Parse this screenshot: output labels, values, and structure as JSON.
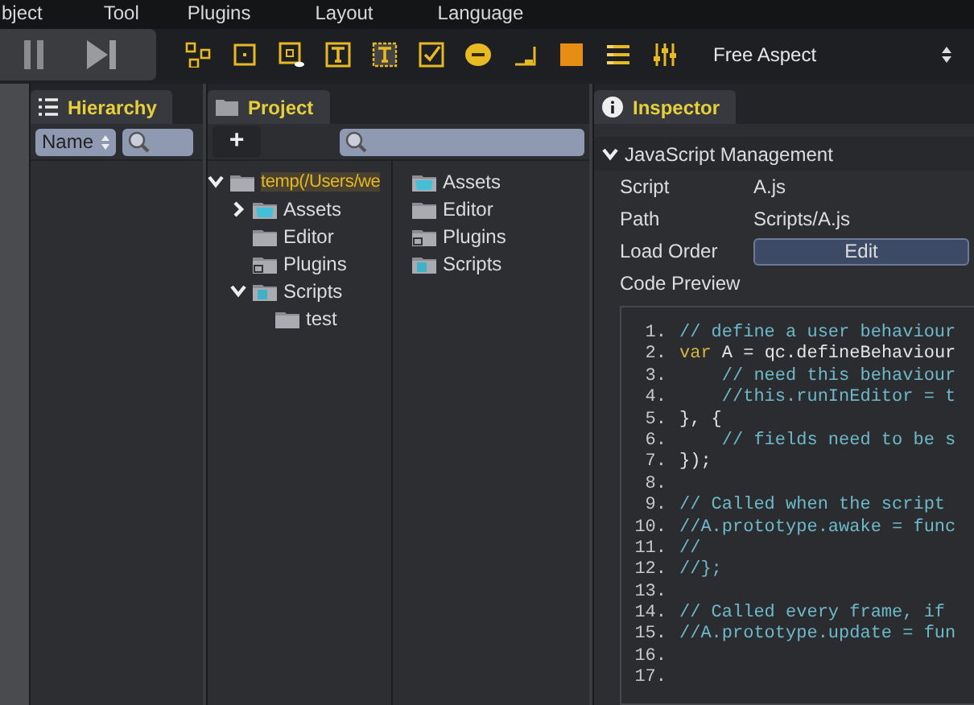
{
  "menu": [
    "bject",
    "Tool",
    "Plugins",
    "Layout",
    "Language"
  ],
  "toolbar": {
    "aspect": "Free Aspect"
  },
  "hierarchy": {
    "title": "Hierarchy",
    "sort": "Name"
  },
  "project": {
    "title": "Project",
    "add": "+",
    "tree": [
      {
        "label": "temp(/Users/we",
        "kind": "plain",
        "selected": true,
        "expanded": true,
        "children": [
          {
            "label": "Assets",
            "kind": "assets",
            "selected": false,
            "expanded": false
          },
          {
            "label": "Editor",
            "kind": "plain",
            "selected": false
          },
          {
            "label": "Plugins",
            "kind": "plugins",
            "selected": false
          },
          {
            "label": "Scripts",
            "kind": "scripts",
            "selected": false,
            "expanded": true,
            "children": [
              {
                "label": "test",
                "kind": "plain",
                "selected": false
              }
            ]
          }
        ]
      }
    ],
    "files": [
      {
        "label": "Assets",
        "kind": "assets"
      },
      {
        "label": "Editor",
        "kind": "plain"
      },
      {
        "label": "Plugins",
        "kind": "plugins"
      },
      {
        "label": "Scripts",
        "kind": "scripts"
      }
    ]
  },
  "inspector": {
    "title": "Inspector",
    "section": {
      "title": "JavaScript Management",
      "expanded": true
    },
    "props": [
      {
        "label": "Script",
        "value": "A.js",
        "kind": "text"
      },
      {
        "label": "Path",
        "value": "Scripts/A.js",
        "kind": "text"
      },
      {
        "label": "Load Order",
        "value": "Edit",
        "kind": "button"
      }
    ],
    "code_label": "Code Preview",
    "code": [
      {
        "n": "1.",
        "comment": "// define a user behaviour"
      },
      {
        "n": "2.",
        "keyword": "var",
        "code": "A = qc.defineBehaviour"
      },
      {
        "n": "3.",
        "comment": "    // need this behaviour"
      },
      {
        "n": "4.",
        "comment": "    //this.runInEditor = t"
      },
      {
        "n": "5.",
        "code": "}, {"
      },
      {
        "n": "6.",
        "comment": "    // fields need to be s"
      },
      {
        "n": "7.",
        "code": "});"
      },
      {
        "n": "8."
      },
      {
        "n": "9.",
        "comment": "// Called when the script"
      },
      {
        "n": "10.",
        "comment": "//A.prototype.awake = func"
      },
      {
        "n": "11.",
        "comment": "//"
      },
      {
        "n": "12.",
        "comment": "//};"
      },
      {
        "n": "13."
      },
      {
        "n": "14.",
        "comment": "// Called every frame, if"
      },
      {
        "n": "15.",
        "comment": "//A.prototype.update = fun"
      },
      {
        "n": "16."
      },
      {
        "n": "17."
      }
    ]
  }
}
